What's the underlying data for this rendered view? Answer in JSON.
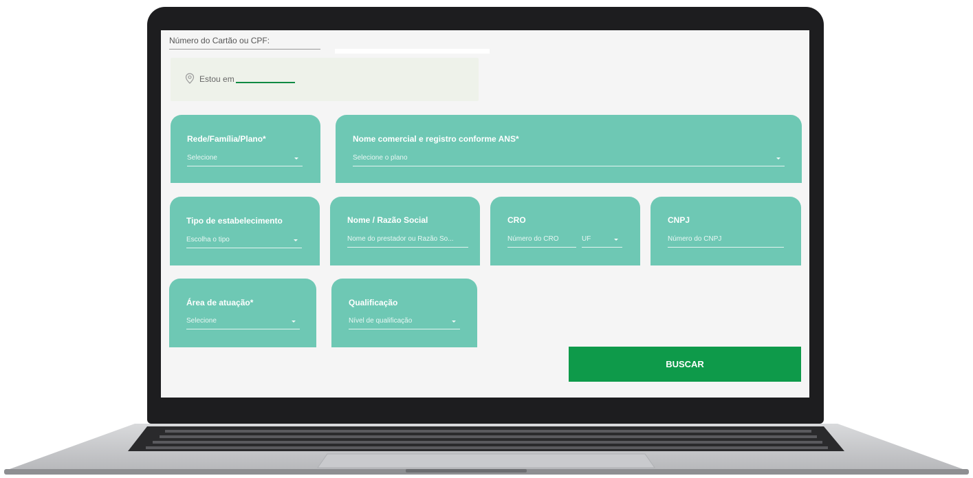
{
  "search": {
    "card_label": "Número do Cartão ou CPF:",
    "location_label": "Estou em"
  },
  "filters": {
    "rede": {
      "title": "Rede/Família/Plano*",
      "placeholder": "Selecione"
    },
    "nome_comercial": {
      "title": "Nome comercial e registro conforme ANS*",
      "placeholder": "Selecione o plano"
    },
    "tipo": {
      "title": "Tipo de estabelecimento",
      "placeholder": "Escolha o tipo"
    },
    "razao": {
      "title": "Nome / Razão Social",
      "placeholder": "Nome do prestador ou Razão So..."
    },
    "cro": {
      "title": "CRO",
      "placeholder": "Número do CRO",
      "uf": "UF"
    },
    "cnpj": {
      "title": "CNPJ",
      "placeholder": "Número do CNPJ"
    },
    "area": {
      "title": "Área de atuação*",
      "placeholder": "Selecione"
    },
    "qualificacao": {
      "title": "Qualificação",
      "placeholder": "Nível de qualificação"
    }
  },
  "actions": {
    "search_label": "BUSCAR"
  },
  "colors": {
    "panel": "#6ec8b4",
    "button": "#0e9a4a",
    "accent_line": "#0f8a43"
  },
  "icons": {
    "location": "map-pin-icon",
    "dropdown": "chevron-down-icon"
  }
}
